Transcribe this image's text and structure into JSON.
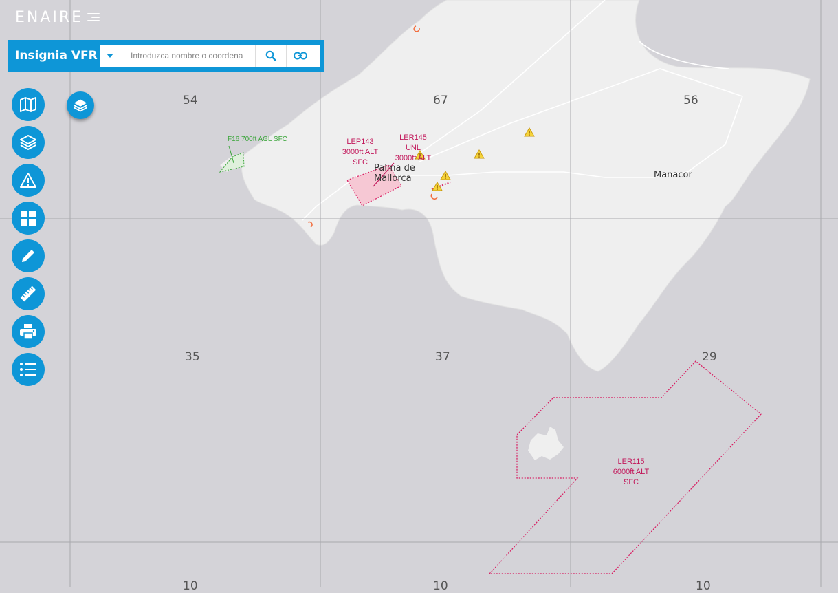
{
  "app": {
    "logo_text": "ENAIRE",
    "title": "Insignia VFR"
  },
  "search": {
    "placeholder": "Introduzca nombre o coordena"
  },
  "toolbar": {
    "buttons": [
      {
        "name": "map-icon"
      },
      {
        "name": "layers-icon"
      },
      {
        "name": "warning-icon"
      },
      {
        "name": "grid-icon"
      },
      {
        "name": "pencil-icon"
      },
      {
        "name": "ruler-icon"
      },
      {
        "name": "printer-icon"
      },
      {
        "name": "list-icon"
      }
    ],
    "layer_fab_icon": "layers-icon"
  },
  "map": {
    "grid_labels": [
      "54",
      "67",
      "56",
      "35",
      "37",
      "29",
      "10",
      "10",
      "10"
    ],
    "places": {
      "palma": [
        "Palma de",
        "Mallorca"
      ],
      "manacor": "Manacor"
    },
    "zones": {
      "lep143": {
        "name": "LEP143",
        "upper": "3000ft ALT",
        "lower": "SFC"
      },
      "ler145": {
        "name": "LER145",
        "upper": "UNL",
        "lower": "3000ft ALT"
      },
      "ler115": {
        "name": "LER115",
        "upper": "6000ft ALT",
        "lower": "SFC"
      },
      "f16": {
        "name": "F16",
        "upper": "700ft AGL",
        "lower": "SFC"
      }
    },
    "colors": {
      "sea": "#d4d3d8",
      "land": "#efefef",
      "restricted": "#d81b60",
      "glider": "#3aa53a",
      "accent": "#0e96d7"
    }
  }
}
